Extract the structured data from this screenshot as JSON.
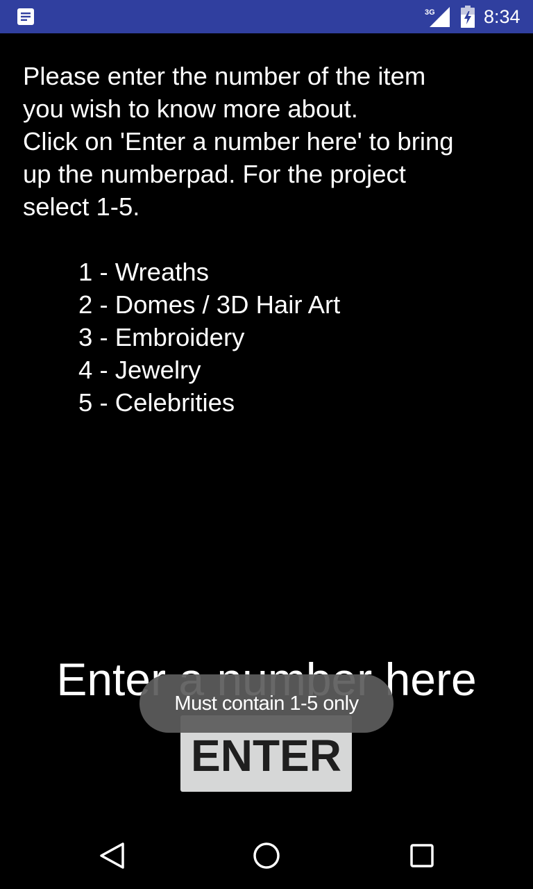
{
  "status_bar": {
    "time": "8:34",
    "network_type": "3G",
    "background_color": "#303f9f",
    "icons": [
      "notification-icon",
      "signal-icon",
      "battery-icon"
    ]
  },
  "instructions": {
    "lines": [
      "Please enter the number of the item",
      "you wish to know more about.",
      "Click on 'Enter a number here' to bring",
      "up the numberpad. For the project",
      "select 1-5."
    ]
  },
  "items": [
    {
      "label": "1 - Wreaths"
    },
    {
      "label": "2 - Domes / 3D Hair Art"
    },
    {
      "label": "3 - Embroidery"
    },
    {
      "label": "4 - Jewelry"
    },
    {
      "label": "5 - Celebrities"
    }
  ],
  "number_field": {
    "value": "",
    "placeholder": "Enter a number here"
  },
  "enter_button": {
    "label": "ENTER",
    "background_color": "#d6d7d7"
  },
  "toast": {
    "message": "Must contain 1-5 only"
  },
  "nav_bar": {
    "icons": [
      "back-icon",
      "home-icon",
      "recents-icon"
    ]
  }
}
